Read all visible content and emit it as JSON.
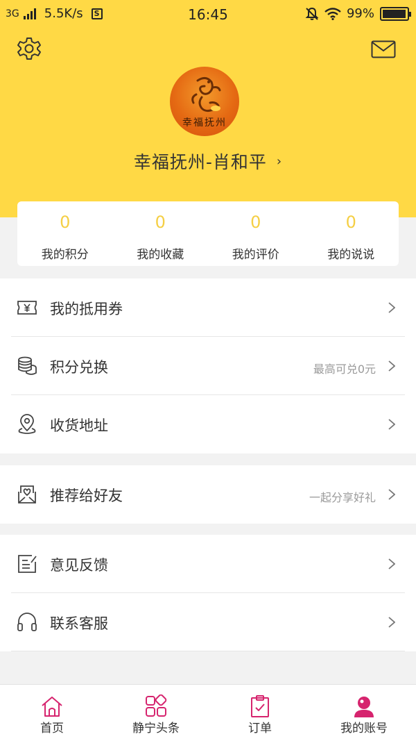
{
  "status_bar": {
    "network": "3G",
    "speed": "5.5K/s",
    "s_icon": "S",
    "time": "16:45",
    "battery": "99%"
  },
  "header": {
    "bg_color": "#ffd945",
    "avatar_text": "幸福抚州",
    "username": "幸福抚州-肖和平",
    "username_chevron": "›"
  },
  "stats": [
    {
      "value": "0",
      "label": "我的积分"
    },
    {
      "value": "0",
      "label": "我的收藏"
    },
    {
      "value": "0",
      "label": "我的评价"
    },
    {
      "value": "0",
      "label": "我的说说"
    }
  ],
  "menu": {
    "coupons": {
      "label": "我的抵用券",
      "icon": "ticket-yen-icon"
    },
    "points_exchange": {
      "label": "积分兑换",
      "hint": "最高可兑0元",
      "icon": "coins-stack-icon"
    },
    "address": {
      "label": "收货地址",
      "icon": "location-pin-icon"
    },
    "recommend": {
      "label": "推荐给好友",
      "hint": "一起分享好礼",
      "icon": "heart-envelope-icon"
    },
    "feedback": {
      "label": "意见反馈",
      "icon": "edit-note-icon"
    },
    "customer_service": {
      "label": "联系客服",
      "icon": "headset-icon"
    }
  },
  "tabbar": [
    {
      "label": "首页",
      "icon": "home-icon"
    },
    {
      "label": "静宁头条",
      "icon": "grid-apps-icon"
    },
    {
      "label": "订单",
      "icon": "clipboard-check-icon"
    },
    {
      "label": "我的账号",
      "icon": "user-icon",
      "active": true
    }
  ],
  "colors": {
    "accent": "#ffd945",
    "stat_number": "#f5cf44",
    "tab_icon": "#d6246e",
    "hint": "#9a9a9a"
  }
}
